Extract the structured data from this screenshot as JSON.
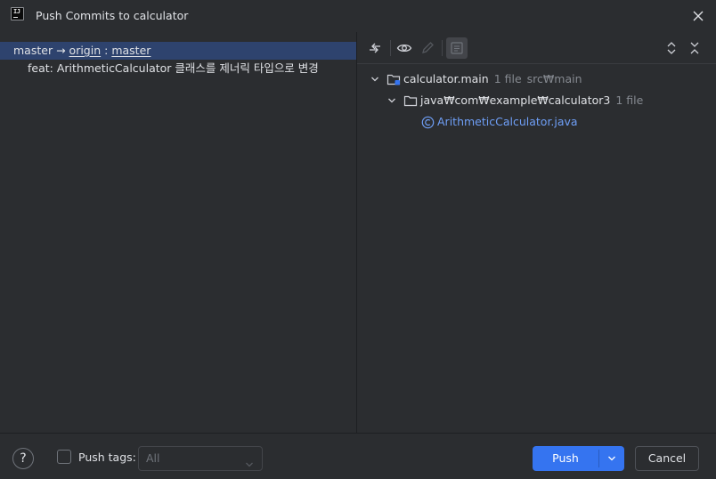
{
  "window": {
    "title": "Push Commits to calculator",
    "logo_text": "IJ"
  },
  "branches": {
    "local": "master",
    "arrow": "→",
    "remote": "origin",
    "separator": ":",
    "remote_branch": "master",
    "commits": [
      {
        "message": "feat: ArithmeticCalculator 클래스를 제너릭 타입으로 변경"
      }
    ]
  },
  "toolbar": {
    "icons": [
      "collapse-arrows-icon",
      "eye-icon",
      "edit-pencil-icon",
      "diff-preview-icon",
      "expand-all-icon",
      "collapse-all-icon"
    ]
  },
  "changes_tree": {
    "module": {
      "name": "calculator.main",
      "count": "1 file",
      "path": "src₩main"
    },
    "package": {
      "name": "java₩com₩example₩calculator3",
      "count": "1 file"
    },
    "file": {
      "name": "ArithmeticCalculator.java"
    }
  },
  "footer": {
    "help_label": "?",
    "push_tags_label": "Push tags:",
    "push_tags_checked": false,
    "tags_selected": "All",
    "push_label": "Push",
    "cancel_label": "Cancel"
  },
  "colors": {
    "background": "#2b2d30",
    "selection": "#2e436e",
    "accent": "#3574f0",
    "link": "#6f9ff7",
    "muted_text": "#868a91"
  }
}
